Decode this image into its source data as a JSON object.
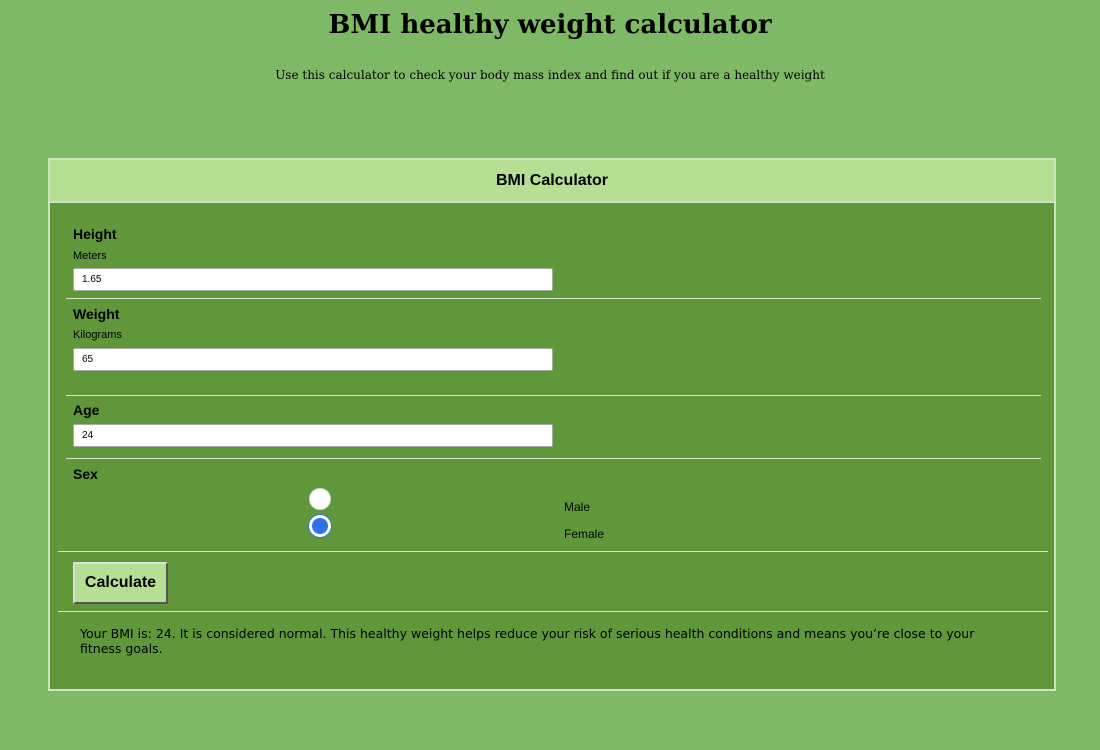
{
  "page": {
    "title": "BMI healthy weight calculator",
    "subtitle": "Use this calculator to check your body mass index and find out if you are a healthy weight"
  },
  "calculator": {
    "header": "BMI Calculator",
    "height": {
      "label": "Height",
      "unit": "Meters",
      "value": "1.65"
    },
    "weight": {
      "label": "Weight",
      "unit": "Kilograms",
      "value": "65"
    },
    "age": {
      "label": "Age",
      "value": "24"
    },
    "sex": {
      "label": "Sex",
      "options": [
        {
          "label": "Male",
          "checked": false
        },
        {
          "label": "Female",
          "checked": true
        }
      ]
    },
    "calculate_label": "Calculate",
    "result": "Your BMI is: 24. It is considered normal. This healthy weight helps reduce your risk of serious health conditions and means you’re close to your fitness goals."
  },
  "colors": {
    "page_background": "#7eb966",
    "panel_background": "#5f973a",
    "header_background": "#b7df93",
    "radio_selected": "#2b73e8"
  }
}
